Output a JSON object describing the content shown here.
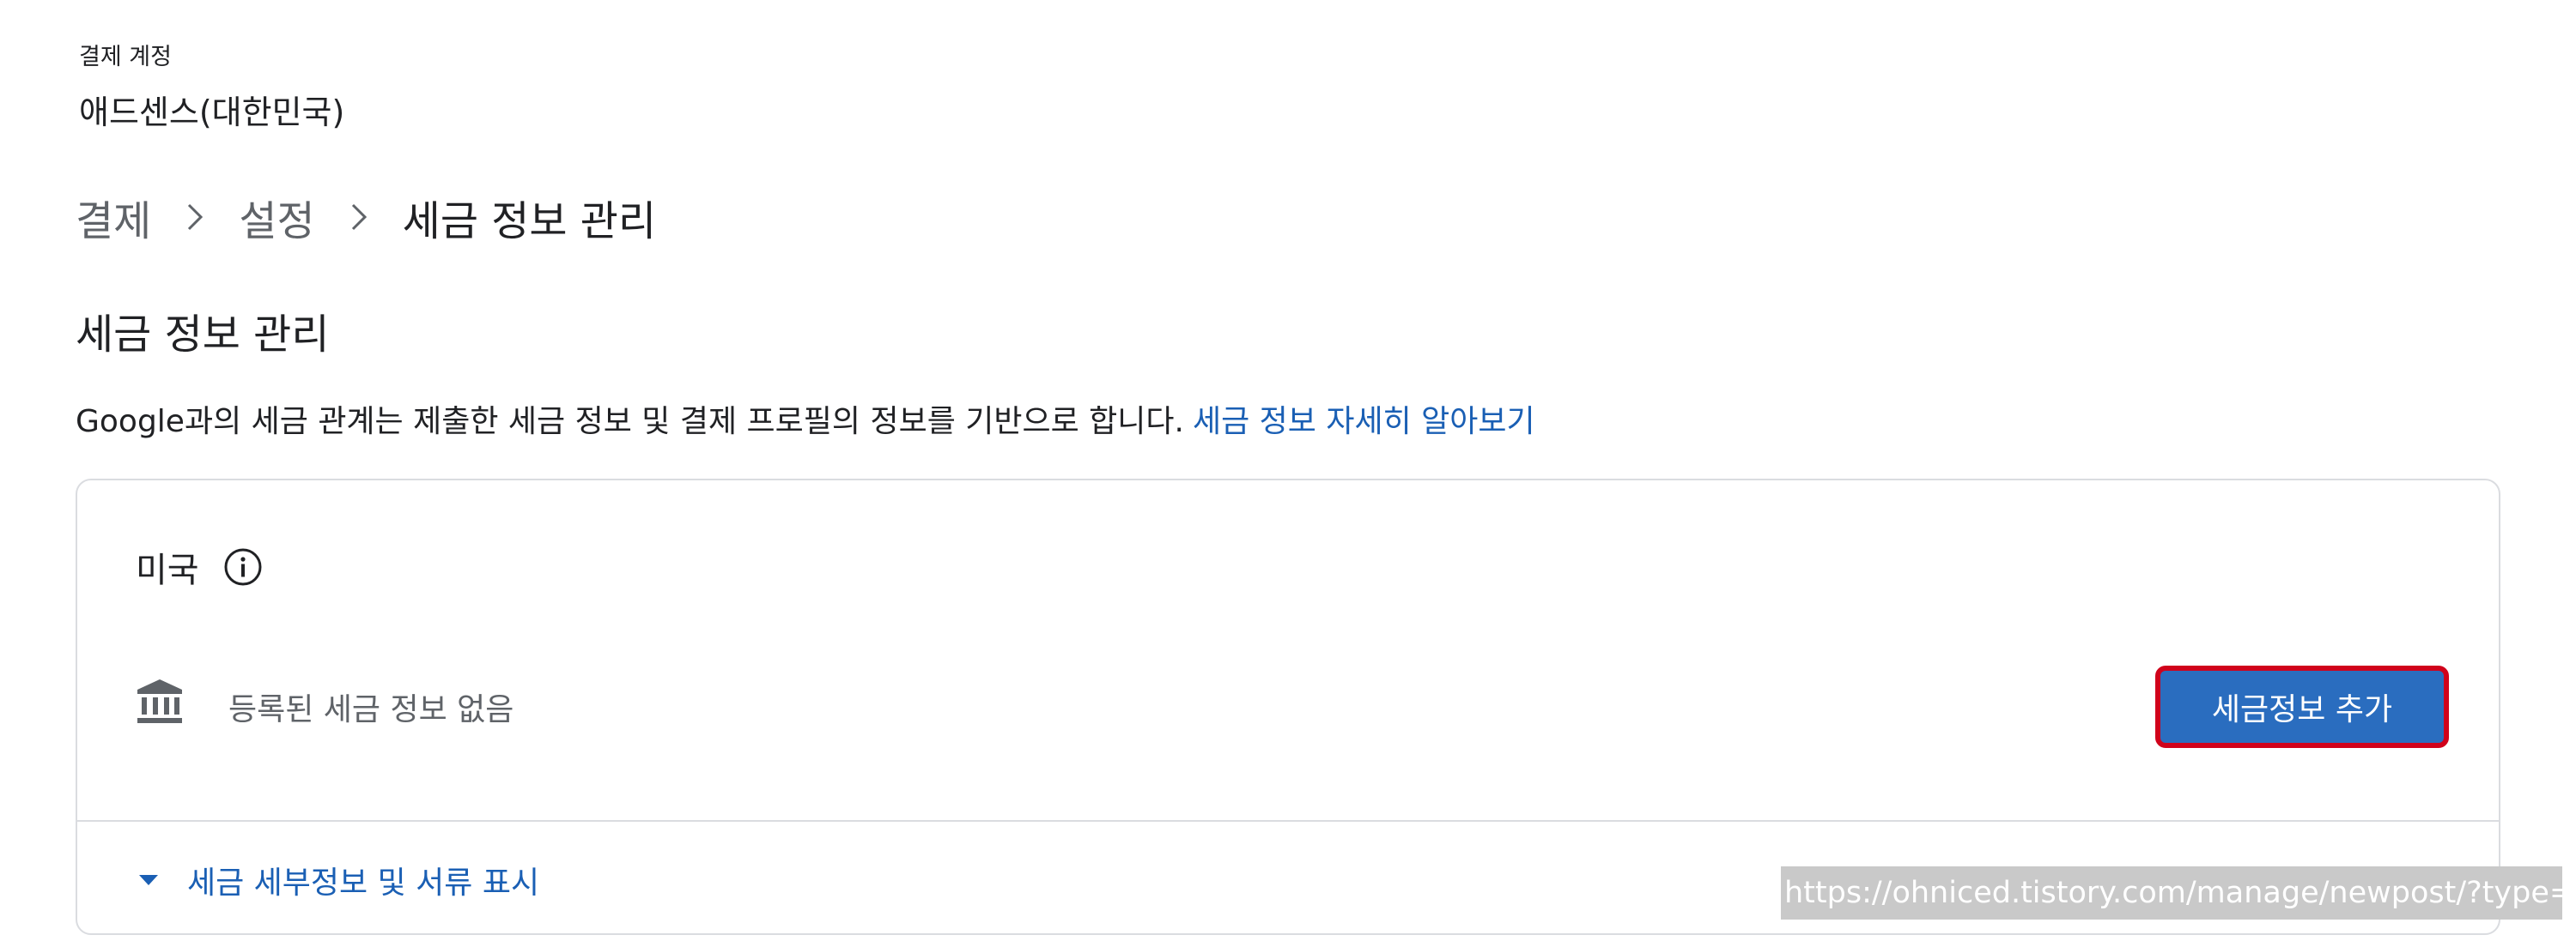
{
  "account": {
    "label": "결제 계정",
    "name": "애드센스(대한민국)"
  },
  "breadcrumb": {
    "items": [
      "결제",
      "설정",
      "세금 정보 관리"
    ]
  },
  "page": {
    "title": "세금 정보 관리",
    "description": "Google과의 세금 관계는 제출한 세금 정보 및 결제 프로필의 정보를 기반으로 합니다.",
    "learn_more_link": "세금 정보 자세히 알아보기"
  },
  "tax_card": {
    "country": "미국",
    "empty_status": "등록된 세금 정보 없음",
    "add_button_label": "세금정보 추가",
    "details_toggle_label": "세금 세부정보 및 서류 표시"
  },
  "overlay": {
    "url_text": "https://ohniced.tistory.com/manage/newpost/?type=p"
  },
  "colors": {
    "link": "#1a5fb4",
    "button": "#2a6dbf",
    "button_highlight_border": "#d0021b",
    "muted_text": "#5f6368",
    "border": "#dadce0"
  },
  "icons": {
    "info": "info-icon",
    "bank": "bank-icon",
    "caret": "caret-down-icon",
    "breadcrumb_separator": "chevron-right-icon"
  }
}
